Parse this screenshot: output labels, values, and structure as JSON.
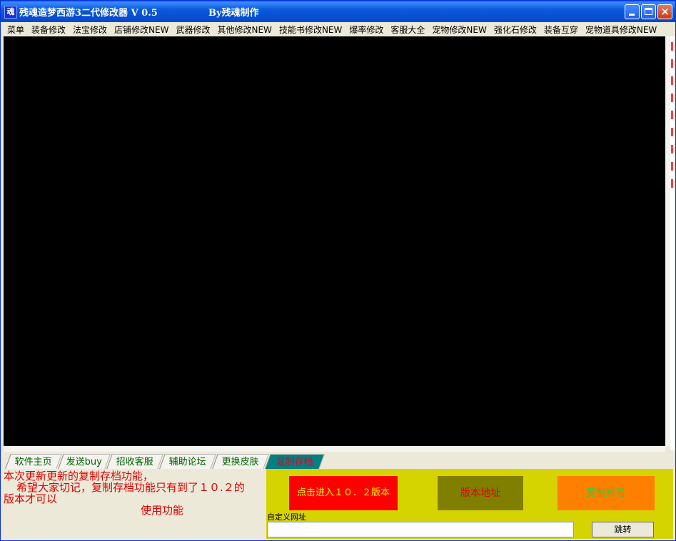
{
  "window": {
    "title": "残魂造梦西游3二代修改器 V 0.5",
    "author": "By残魂制作",
    "icon_label": "魂"
  },
  "menu": {
    "items": [
      "菜单",
      "装备修改",
      "法宝修改",
      "店铺修改NEW",
      "武器修改",
      "其他修改NEW",
      "技能书修改NEW",
      "爆率修改",
      "客服大全",
      "宠物修改NEW",
      "强化石修改",
      "装备互穿",
      "宠物道具修改NEW"
    ]
  },
  "tabs": {
    "items": [
      "软件主页",
      "发送buy",
      "招收客服",
      "辅助论坛",
      "更换皮肤",
      "复制存档"
    ],
    "active_index": 5
  },
  "notice": {
    "line1": "本次更新更新的复制存档功能，",
    "line2": "希望大家切记，复制存档功能只有到了１０.２的",
    "line3": "版本才可以",
    "line4": "使用功能"
  },
  "buttons": {
    "enter_label": "点击进入１０．２版本",
    "version_label": "版本地址",
    "copy_label": "复制账号",
    "jump_label": "跳转"
  },
  "url": {
    "label": "自定义网址",
    "value": ""
  },
  "colors": {
    "titlebar": "#0A5FE8",
    "panel_right_bg": "#D6D400",
    "enter_bg": "#FF0000",
    "version_bg": "#807F00",
    "copy_bg": "#FF8000",
    "active_tab_bg": "#008080"
  }
}
